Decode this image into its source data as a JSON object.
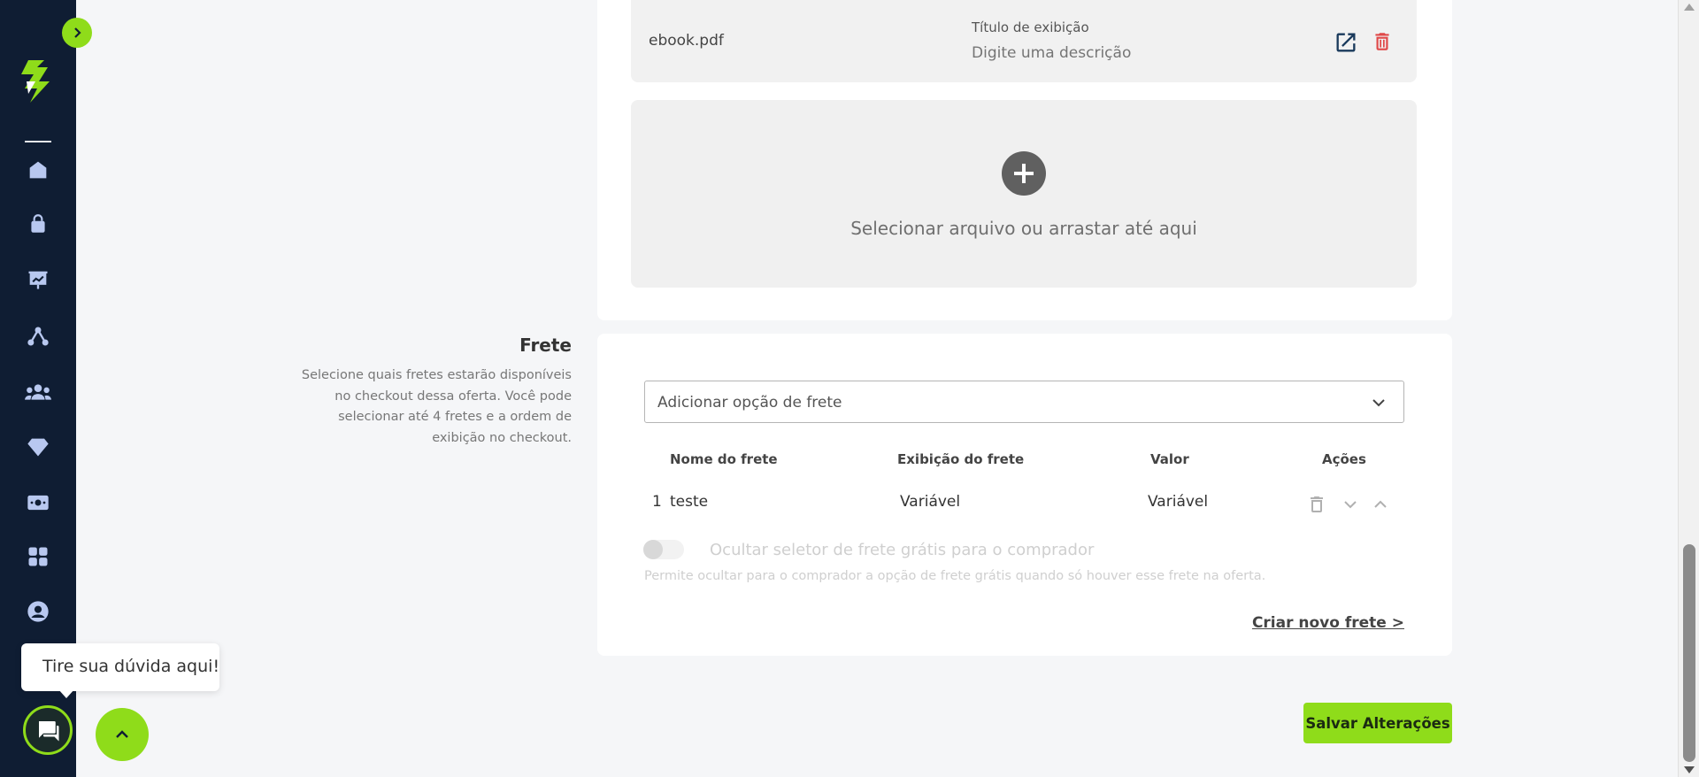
{
  "file": {
    "name": "ebook.pdf",
    "display_title_label": "Título de exibição",
    "display_title_placeholder": "Digite uma descrição"
  },
  "dropzone": {
    "text": "Selecionar arquivo ou arrastar até aqui"
  },
  "shipping": {
    "section_title": "Frete",
    "section_description": "Selecione quais fretes estarão disponíveis no checkout dessa oferta. Você pode selecionar até 4 fretes e a ordem de exibição no checkout.",
    "select_placeholder": "Adicionar opção de frete",
    "columns": {
      "name": "Nome do frete",
      "display": "Exibição do frete",
      "value": "Valor",
      "actions": "Ações"
    },
    "rows": [
      {
        "index": "1",
        "name": "teste",
        "display": "Variável",
        "value": "Variável"
      }
    ],
    "hide_free_toggle_label": "Ocultar seletor de frete grátis para o comprador",
    "hide_free_toggle_help": "Permite ocultar para o comprador a opção de frete grátis quando só houver esse frete na oferta.",
    "hide_free_toggle_on": false,
    "create_link": "Criar novo frete >"
  },
  "actions": {
    "save_label": "Salvar Alterações"
  },
  "help": {
    "tooltip": "Tire sua dúvida aqui!"
  },
  "colors": {
    "brand_green": "#8fdc1a",
    "sidebar_bg": "#0f1d33",
    "danger": "#e04848"
  },
  "sidebar": {
    "icons": [
      "home-icon",
      "shopping-bag-icon",
      "presentation-chart-icon",
      "affiliate-network-icon",
      "team-icon",
      "diamond-icon",
      "money-icon",
      "apps-grid-icon",
      "account-circle-icon"
    ]
  }
}
